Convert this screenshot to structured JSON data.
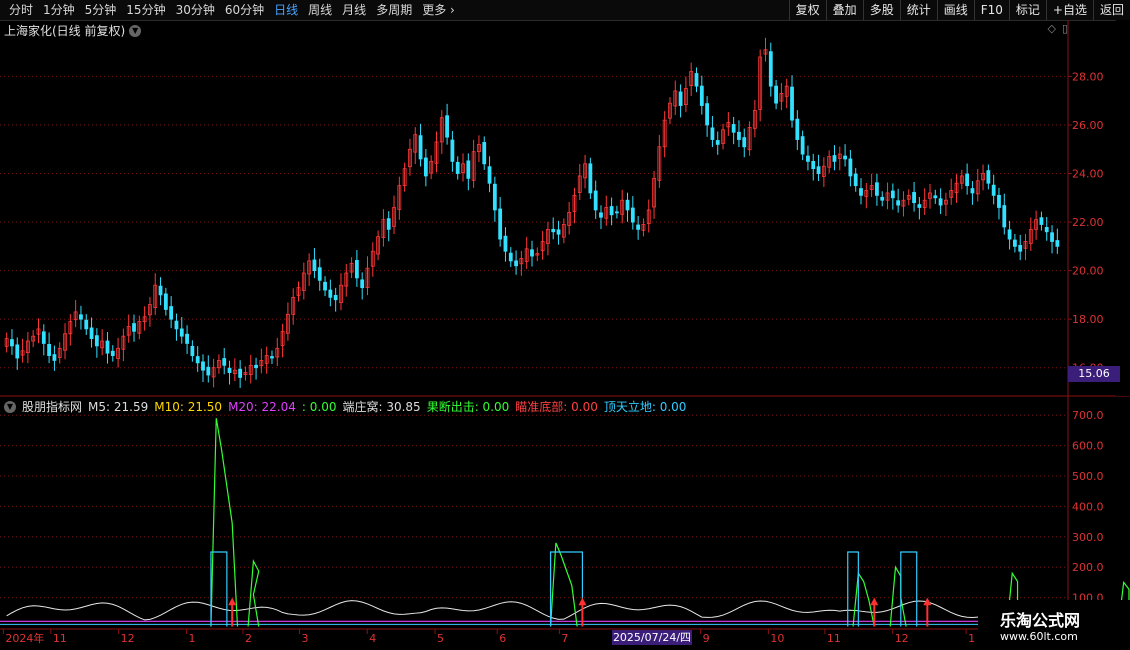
{
  "toolbar": {
    "tabs": [
      "分时",
      "1分钟",
      "5分钟",
      "15分钟",
      "30分钟",
      "60分钟",
      "日线",
      "周线",
      "月线",
      "多周期",
      "更多"
    ],
    "active": "日线",
    "right": [
      "复权",
      "叠加",
      "多股",
      "统计",
      "画线",
      "F10",
      "标记",
      "+自选",
      "返回"
    ]
  },
  "main": {
    "title": "上海家化(日线 前复权)",
    "y_ticks": [
      "28.00",
      "26.00",
      "24.00",
      "22.00",
      "20.00",
      "18.00",
      "16.00"
    ],
    "last_price": "15.06"
  },
  "indicator": {
    "name": "股朋指标网",
    "items": [
      {
        "label": "M5:",
        "value": "21.59",
        "color": "#dcdcdc"
      },
      {
        "label": "M10:",
        "value": "21.50",
        "color": "#ffd700"
      },
      {
        "label": "M20:",
        "value": "22.04",
        "color": "#e040fb"
      },
      {
        "label": ":",
        "value": "0.00",
        "color": "#33ff33"
      },
      {
        "label": "端庄窝:",
        "value": "30.85",
        "color": "#dcdcdc"
      },
      {
        "label": "果断出击:",
        "value": "0.00",
        "color": "#33ff33"
      },
      {
        "label": "瞄准底部:",
        "value": "0.00",
        "color": "#ff4040"
      },
      {
        "label": "顶天立地:",
        "value": "0.00",
        "color": "#33ccff"
      }
    ],
    "y_ticks": [
      "700.0",
      "600.0",
      "500.0",
      "400.0",
      "300.0",
      "200.0",
      "100.0"
    ]
  },
  "xaxis": {
    "labels": [
      {
        "t": "2024年",
        "x": 0.003
      },
      {
        "t": "11",
        "x": 0.045
      },
      {
        "t": "12",
        "x": 0.105
      },
      {
        "t": "1",
        "x": 0.165
      },
      {
        "t": "2",
        "x": 0.215
      },
      {
        "t": "3",
        "x": 0.265
      },
      {
        "t": "4",
        "x": 0.325
      },
      {
        "t": "5",
        "x": 0.385
      },
      {
        "t": "6",
        "x": 0.44
      },
      {
        "t": "7",
        "x": 0.495
      },
      {
        "t": "9",
        "x": 0.62
      },
      {
        "t": "10",
        "x": 0.68
      },
      {
        "t": "11",
        "x": 0.73
      },
      {
        "t": "12",
        "x": 0.79
      },
      {
        "t": "1",
        "x": 0.855
      }
    ],
    "cursor_date": "2025/07/24/四"
  },
  "chart_data": [
    {
      "type": "candlestick",
      "ylim": [
        15.0,
        29.5
      ],
      "y_ticks": [
        16,
        18,
        20,
        22,
        24,
        26,
        28
      ],
      "closes": [
        17.2,
        16.9,
        16.4,
        16.7,
        17.1,
        17.3,
        17.6,
        17.0,
        16.5,
        16.3,
        16.8,
        17.4,
        17.9,
        18.3,
        18.0,
        17.6,
        17.2,
        16.9,
        17.1,
        16.6,
        16.5,
        16.8,
        17.3,
        17.7,
        17.5,
        17.9,
        18.1,
        18.6,
        19.4,
        19.0,
        18.4,
        18.0,
        17.6,
        17.3,
        17.0,
        16.5,
        16.2,
        15.9,
        15.7,
        16.0,
        16.3,
        16.1,
        15.8,
        15.9,
        15.6,
        15.8,
        16.1,
        16.0,
        16.3,
        16.5,
        16.4,
        16.8,
        17.5,
        18.2,
        18.9,
        19.3,
        19.9,
        20.4,
        20.0,
        19.6,
        19.2,
        18.9,
        18.8,
        19.4,
        19.9,
        20.3,
        19.7,
        19.3,
        20.1,
        20.8,
        21.4,
        22.1,
        21.7,
        22.6,
        23.5,
        24.2,
        25.0,
        25.6,
        24.6,
        23.9,
        24.5,
        25.3,
        26.3,
        25.5,
        24.5,
        24.0,
        24.4,
        23.8,
        24.9,
        25.2,
        24.4,
        23.6,
        22.5,
        21.3,
        20.8,
        20.4,
        20.2,
        20.5,
        20.9,
        20.6,
        20.7,
        21.2,
        21.7,
        21.6,
        21.5,
        21.9,
        22.4,
        23.1,
        23.9,
        24.4,
        23.2,
        22.5,
        22.2,
        22.6,
        22.3,
        22.4,
        22.9,
        22.5,
        22.0,
        21.7,
        21.9,
        22.5,
        23.8,
        25.1,
        26.2,
        26.9,
        27.4,
        26.8,
        27.5,
        28.2,
        27.6,
        26.8,
        26.0,
        25.4,
        25.2,
        25.8,
        26.1,
        25.7,
        25.4,
        25.1,
        25.9,
        26.6,
        28.8,
        29.1,
        27.6,
        26.9,
        27.3,
        27.6,
        26.2,
        25.4,
        24.8,
        24.5,
        24.2,
        24.0,
        24.3,
        24.7,
        24.5,
        24.8,
        24.6,
        23.9,
        23.5,
        23.1,
        23.3,
        23.5,
        23.1,
        22.9,
        23.2,
        23.0,
        22.7,
        22.9,
        23.1,
        22.8,
        22.6,
        22.9,
        23.2,
        23.0,
        22.7,
        22.9,
        23.3,
        23.6,
        23.9,
        23.5,
        23.2,
        23.7,
        24.0,
        23.6,
        23.1,
        22.6,
        21.8,
        21.3,
        21.0,
        20.8,
        21.2,
        21.7,
        22.1,
        21.9,
        21.6,
        21.2,
        21.0
      ]
    },
    {
      "type": "line",
      "ylim": [
        0,
        750
      ],
      "y_ticks": [
        100,
        200,
        300,
        400,
        500,
        600,
        700
      ],
      "series": [
        {
          "name": "端庄窝",
          "color": "#e8e8e8"
        },
        {
          "name": "果断出击",
          "color": "#33ff33"
        },
        {
          "name": "顶天立地",
          "color": "#33ccff"
        },
        {
          "name": "瞄准底部",
          "color": "#ff3030"
        }
      ]
    }
  ],
  "watermark": {
    "line1": "乐淘公式网",
    "line2": "www.60lt.com"
  },
  "colors": {
    "up": "#ff3838",
    "down": "#33e0ff",
    "grid": "#7a1010",
    "axis": "#c0c0c0"
  }
}
